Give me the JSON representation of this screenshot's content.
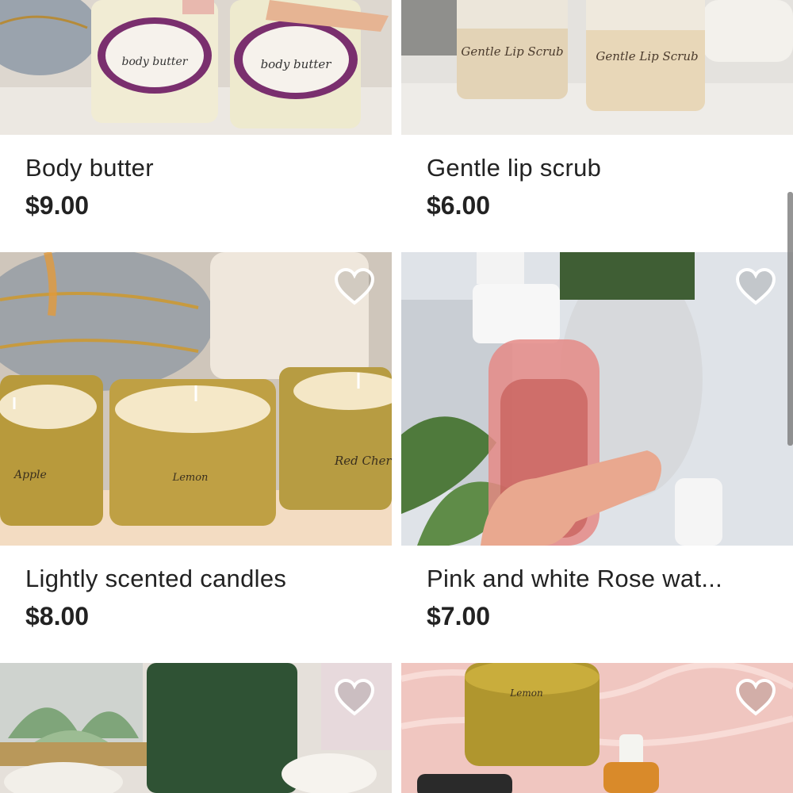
{
  "listings": [
    {
      "title": "Body butter",
      "price": "$9.00",
      "jar_label": "body butter"
    },
    {
      "title": "Gentle lip scrub",
      "price": "$6.00",
      "jar_label": "Gentle Lip Scrub"
    },
    {
      "title": "Lightly scented candles",
      "price": "$8.00",
      "candle_labels": [
        "Apple",
        "Lemon",
        "Red Cher"
      ]
    },
    {
      "title": "Pink and white Rose wat...",
      "price": "$7.00"
    },
    {},
    {
      "tin_label": "Lemon"
    }
  ],
  "icons": {
    "favorite": "heart-outline-icon"
  }
}
